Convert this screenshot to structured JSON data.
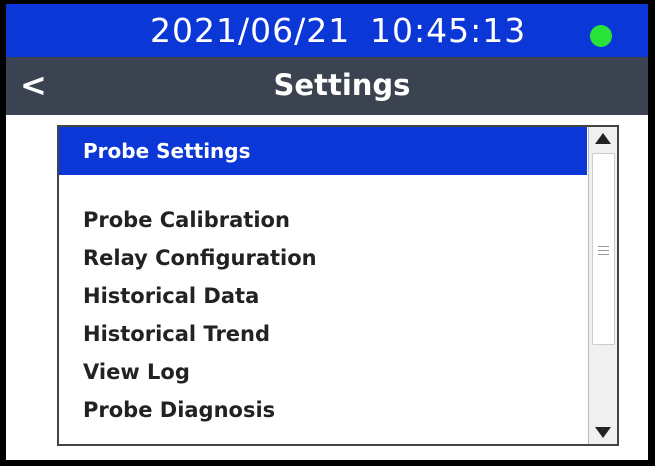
{
  "status_bar": {
    "date": "2021/06/21",
    "time": "10:45:13",
    "indicator_color": "#27e33a"
  },
  "title_bar": {
    "back_label": "<",
    "title": "Settings"
  },
  "list": {
    "header": "Probe Settings",
    "items": [
      "Probe Calibration",
      "Relay Configuration",
      "Historical Data",
      "Historical Trend",
      "View Log",
      "Probe Diagnosis"
    ]
  },
  "colors": {
    "accent_blue": "#0a37d6",
    "title_bar_bg": "#3b4350"
  }
}
